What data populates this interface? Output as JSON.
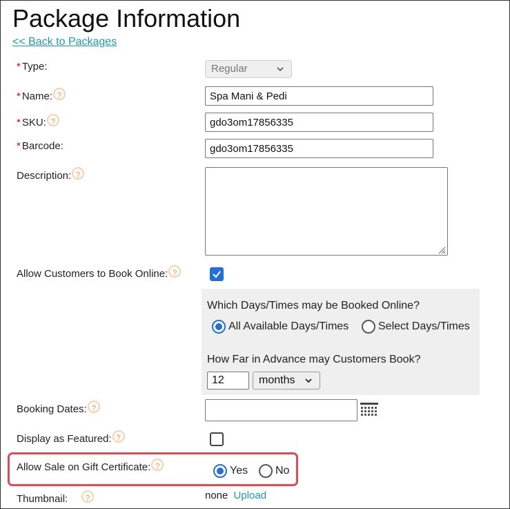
{
  "page": {
    "title": "Package Information",
    "back_link": "<< Back to Packages",
    "required_mark": "*",
    "help_glyph": "?"
  },
  "fields": {
    "type": {
      "label": "Type:",
      "value": "Regular"
    },
    "name": {
      "label": "Name:",
      "value": "Spa Mani & Pedi"
    },
    "sku": {
      "label": "SKU:",
      "value": "gdo3om17856335"
    },
    "barcode": {
      "label": "Barcode:",
      "value": "gdo3om17856335"
    },
    "description": {
      "label": "Description:",
      "value": ""
    },
    "book_online": {
      "label": "Allow Customers to Book Online:",
      "checked": true
    },
    "booking_dates": {
      "label": "Booking Dates:",
      "value": ""
    },
    "featured": {
      "label": "Display as Featured:",
      "checked": false
    },
    "gift_certificate": {
      "label": "Allow Sale on Gift Certificate:",
      "yes_label": "Yes",
      "no_label": "No",
      "selected": "Yes"
    },
    "thumbnail": {
      "label": "Thumbnail:",
      "value": "none",
      "upload_label": "Upload"
    }
  },
  "online_panel": {
    "days_question": "Which Days/Times may be Booked Online?",
    "option_all": "All Available Days/Times",
    "option_select": "Select Days/Times",
    "selected": "All Available Days/Times",
    "advance_question": "How Far in Advance may Customers Book?",
    "advance_value": "12",
    "advance_unit": "months"
  },
  "colors": {
    "accent": "#1f6fe0",
    "link": "#1a9aab",
    "required": "#d0021b",
    "help": "#f3b783",
    "highlight": "#e14a52",
    "panel_bg": "#efefef"
  },
  "icons": {
    "help": "help-icon",
    "calendar": "calendar-icon",
    "chevron": "chevron-down-icon",
    "resize": "resize-grip-icon"
  }
}
